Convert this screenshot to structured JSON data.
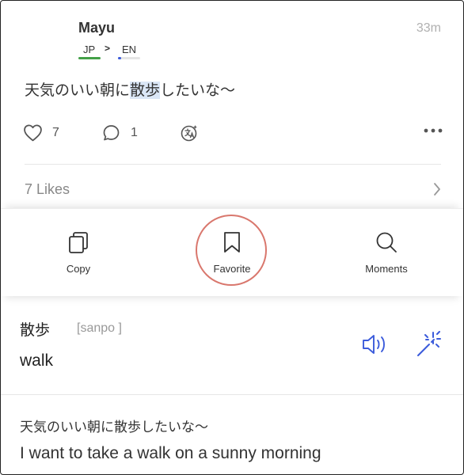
{
  "post": {
    "username": "Mayu",
    "time": "33m",
    "lang_from": "JP",
    "lang_to": "EN",
    "lang_from_level": 1.0,
    "lang_to_level": 0.15,
    "text_before": "天気のいい朝に",
    "text_highlight": "散歩",
    "text_after": "したいな〜",
    "likes_count": "7",
    "comments_count": "1",
    "likes_label": "7 Likes"
  },
  "menu": {
    "copy_label": "Copy",
    "favorite_label": "Favorite",
    "moments_label": "Moments"
  },
  "dictionary": {
    "word": "散歩",
    "reading": "[sanpo ]",
    "meaning": "walk"
  },
  "translation": {
    "source": "天気のいい朝に散歩したいな〜",
    "target": "I want to take a walk on a sunny morning"
  },
  "colors": {
    "accent_blue": "#3b5bdb",
    "lang_green": "#43a047",
    "highlight_ring": "#d9776d",
    "highlight_bg": "#dbe7f7"
  }
}
